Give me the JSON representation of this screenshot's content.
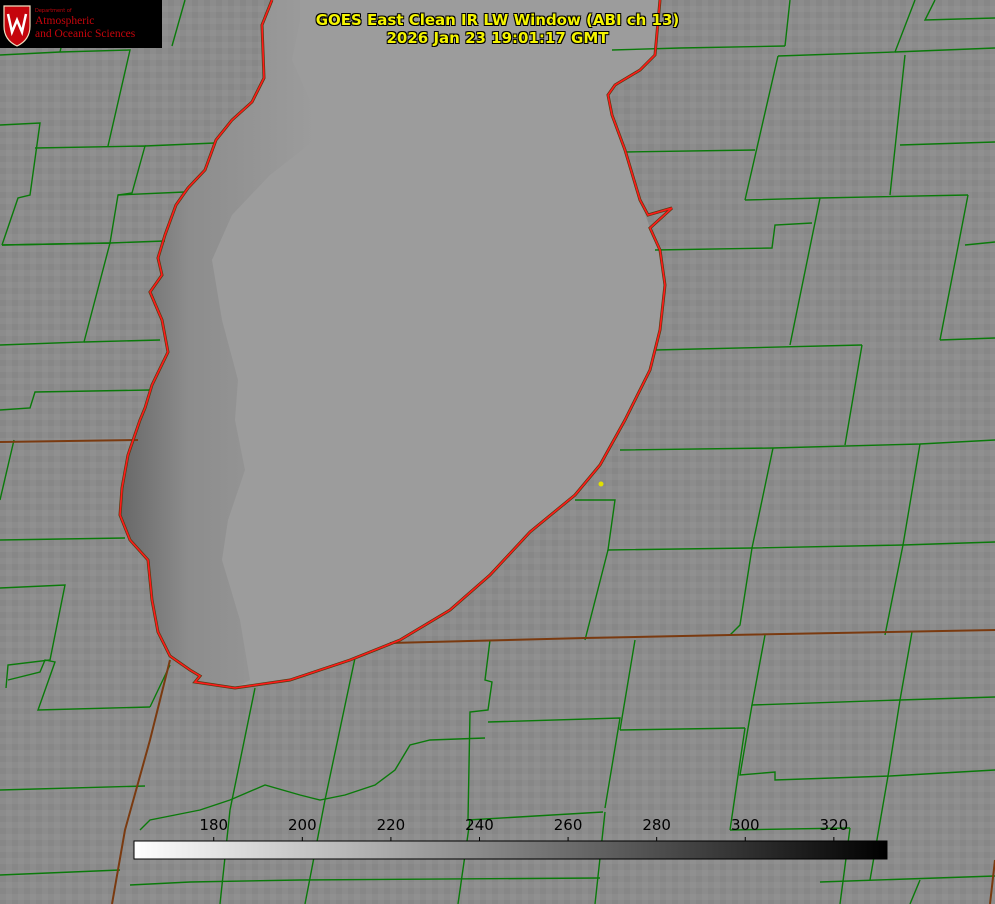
{
  "logo": {
    "dept": "Department of",
    "line1": "Atmospheric",
    "line2": "and Oceanic Sciences",
    "crest_letter": "W"
  },
  "title": {
    "line1": "GOES East Clean IR LW Window (ABI ch 13)",
    "line2": "2026 Jan 23 19:01:17 GMT"
  },
  "colorbar": {
    "ticks": [
      "180",
      "200",
      "220",
      "240",
      "260",
      "280",
      "300",
      "320"
    ],
    "tick_values": [
      180,
      200,
      220,
      240,
      260,
      280,
      300,
      320
    ],
    "range": [
      162,
      332
    ],
    "gradient": "white-to-black"
  },
  "colors": {
    "background_gray": "#8e8e8e",
    "lake_gray": "#9b9b9b",
    "county_lines": "#0a7a0a",
    "coastline": "#ff0000",
    "state_border": "#7a3a10",
    "title_text": "#f4f400",
    "marker": "#e0e000"
  }
}
